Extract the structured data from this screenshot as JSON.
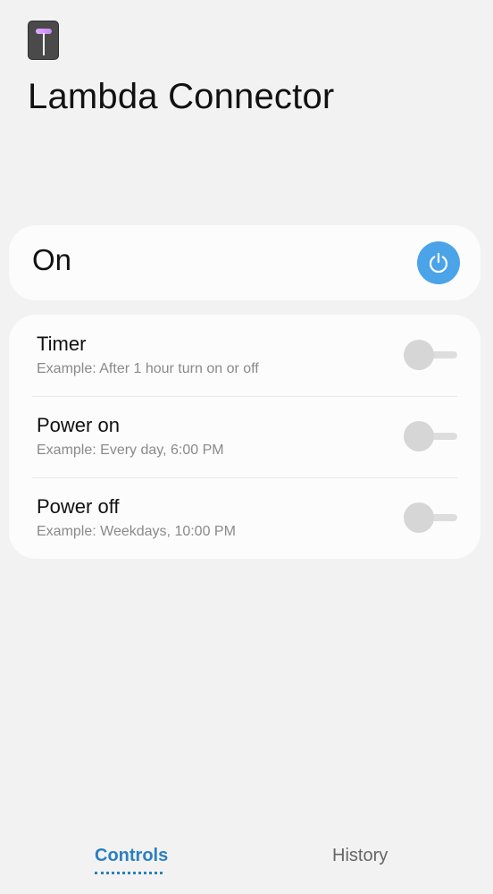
{
  "app": {
    "title": "Lambda Connector",
    "icon": "device-plug-icon",
    "icon_accent": "#d69cf7"
  },
  "power": {
    "state_label": "On",
    "icon": "power-icon",
    "button_color": "#4ba3e8"
  },
  "schedule": {
    "items": [
      {
        "label": "Timer",
        "example": "Example: After 1 hour turn on or off",
        "enabled": false
      },
      {
        "label": "Power on",
        "example": "Example: Every day, 6:00 PM",
        "enabled": false
      },
      {
        "label": "Power off",
        "example": "Example: Weekdays, 10:00 PM",
        "enabled": false
      }
    ]
  },
  "nav": {
    "tabs": [
      {
        "label": "Controls",
        "active": true
      },
      {
        "label": "History",
        "active": false
      }
    ],
    "accent": "#2b7fc0"
  }
}
